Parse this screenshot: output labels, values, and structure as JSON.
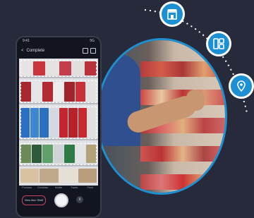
{
  "phone": {
    "status_time": "9:41",
    "status_signal": "5G",
    "header_back": "<",
    "header_title": "Complete",
    "tabs": [
      "Products",
      "Gondolas",
      "Mobile",
      "Faces",
      "Fixed"
    ],
    "action_button": "View Item Shelf",
    "close_label": "x"
  },
  "colors": {
    "background": "#262a3a",
    "accent": "#1d8fd3",
    "badge_border": "#ffffff",
    "pill_border": "#c8455e"
  },
  "icons": [
    "store-icon",
    "layout-icon",
    "location-pin-icon"
  ]
}
